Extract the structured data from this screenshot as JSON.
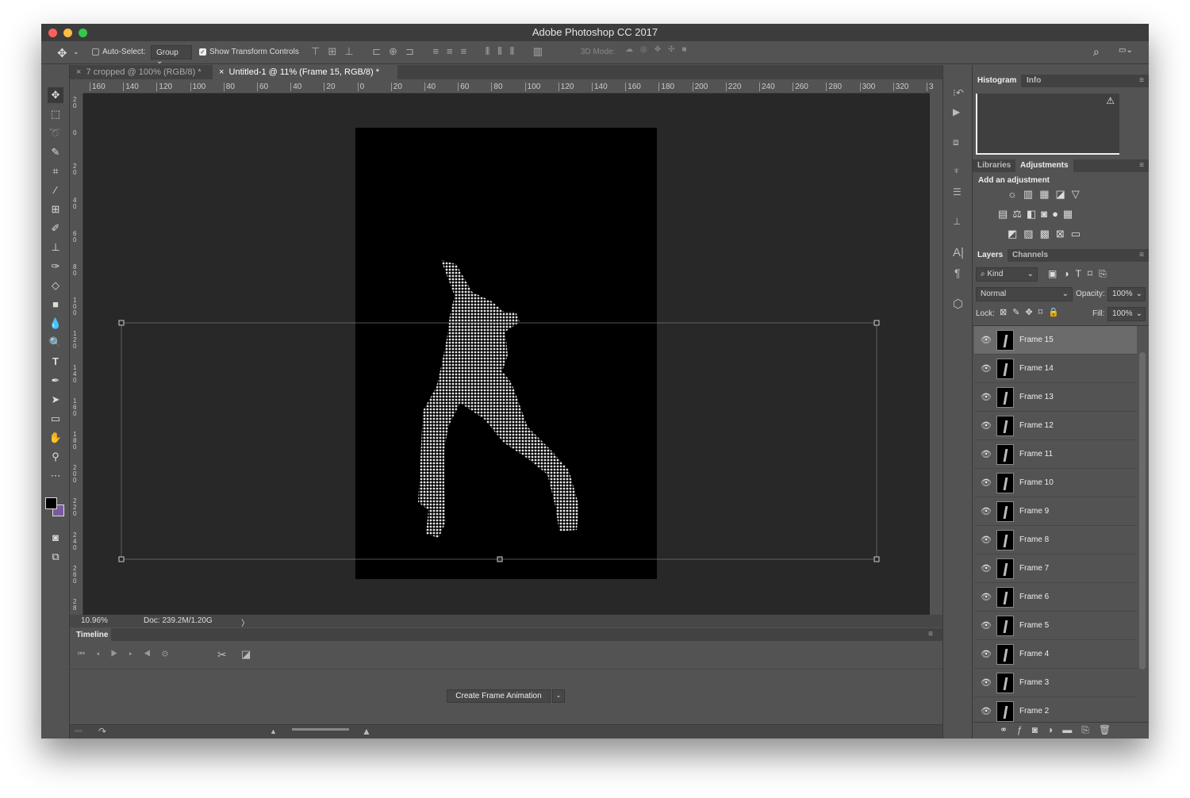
{
  "window": {
    "title": "Adobe Photoshop CC 2017"
  },
  "options": {
    "auto_select_label": "Auto-Select:",
    "auto_select_checked": false,
    "auto_select_mode": "Group",
    "show_transform_label": "Show Transform Controls",
    "show_transform_checked": true,
    "mode_3d_label": "3D Mode:"
  },
  "doc_tabs": [
    {
      "label": "7 cropped @ 100% (RGB/8) *",
      "active": false
    },
    {
      "label": "Untitled-1 @ 11% (Frame 15, RGB/8) *",
      "active": true
    }
  ],
  "ruler": {
    "h_ticks": [
      "160",
      "140",
      "120",
      "100",
      "80",
      "60",
      "40",
      "20",
      "0",
      "20",
      "40",
      "60",
      "80",
      "100",
      "120",
      "140",
      "160",
      "180",
      "200",
      "220",
      "240",
      "260",
      "280",
      "300",
      "320",
      "3"
    ],
    "v_ticks": [
      "2 0",
      "0",
      "2 0",
      "4 0",
      "6 0",
      "8 0",
      "1 0 0",
      "1 2 0",
      "1 4 0",
      "1 6 0",
      "1 8 0",
      "2 0 0",
      "2 2 0",
      "2 4 0",
      "2 6 0",
      "2 8"
    ]
  },
  "status": {
    "zoom": "10.96%",
    "doc": "Doc: 239.2M/1.20G",
    "arrow": "〉"
  },
  "timeline": {
    "title": "Timeline",
    "create_button": "Create Frame Animation"
  },
  "histogram": {
    "tabs": [
      "Histogram",
      "Info"
    ]
  },
  "adjustments": {
    "tabs": [
      "Libraries",
      "Adjustments"
    ],
    "heading": "Add an adjustment"
  },
  "layers_panel": {
    "tabs": [
      "Layers",
      "Channels"
    ],
    "filter": "Kind",
    "blend_mode": "Normal",
    "opacity_label": "Opacity:",
    "opacity": "100%",
    "lock_label": "Lock:",
    "fill_label": "Fill:",
    "fill": "100%",
    "layers": [
      {
        "name": "Frame 15",
        "selected": true
      },
      {
        "name": "Frame 14"
      },
      {
        "name": "Frame 13"
      },
      {
        "name": "Frame 12"
      },
      {
        "name": "Frame 11"
      },
      {
        "name": "Frame 10"
      },
      {
        "name": "Frame 9"
      },
      {
        "name": "Frame 8"
      },
      {
        "name": "Frame 7"
      },
      {
        "name": "Frame 6"
      },
      {
        "name": "Frame 5"
      },
      {
        "name": "Frame 4"
      },
      {
        "name": "Frame 3"
      },
      {
        "name": "Frame 2"
      }
    ]
  },
  "colors": {
    "foreground": "#000000",
    "background": "#7a5aa0"
  }
}
